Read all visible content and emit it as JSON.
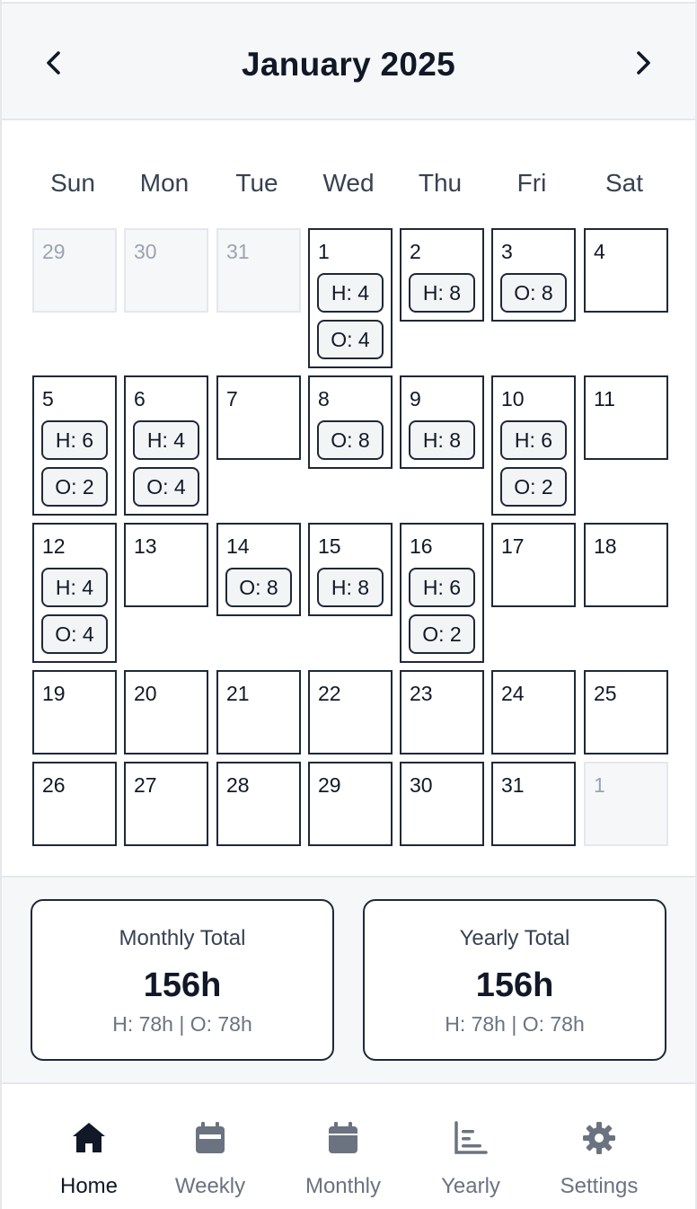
{
  "header": {
    "month_title": "January 2025"
  },
  "weekdays": [
    "Sun",
    "Mon",
    "Tue",
    "Wed",
    "Thu",
    "Fri",
    "Sat"
  ],
  "weeks": [
    [
      {
        "day": "29",
        "muted": true,
        "entries": []
      },
      {
        "day": "30",
        "muted": true,
        "entries": []
      },
      {
        "day": "31",
        "muted": true,
        "entries": []
      },
      {
        "day": "1",
        "muted": false,
        "entries": [
          "H: 4",
          "O: 4"
        ]
      },
      {
        "day": "2",
        "muted": false,
        "entries": [
          "H: 8"
        ]
      },
      {
        "day": "3",
        "muted": false,
        "entries": [
          "O: 8"
        ]
      },
      {
        "day": "4",
        "muted": false,
        "entries": []
      }
    ],
    [
      {
        "day": "5",
        "muted": false,
        "entries": [
          "H: 6",
          "O: 2"
        ]
      },
      {
        "day": "6",
        "muted": false,
        "entries": [
          "H: 4",
          "O: 4"
        ]
      },
      {
        "day": "7",
        "muted": false,
        "entries": []
      },
      {
        "day": "8",
        "muted": false,
        "entries": [
          "O: 8"
        ]
      },
      {
        "day": "9",
        "muted": false,
        "entries": [
          "H: 8"
        ]
      },
      {
        "day": "10",
        "muted": false,
        "entries": [
          "H: 6",
          "O: 2"
        ]
      },
      {
        "day": "11",
        "muted": false,
        "entries": []
      }
    ],
    [
      {
        "day": "12",
        "muted": false,
        "entries": [
          "H: 4",
          "O: 4"
        ]
      },
      {
        "day": "13",
        "muted": false,
        "entries": []
      },
      {
        "day": "14",
        "muted": false,
        "entries": [
          "O: 8"
        ]
      },
      {
        "day": "15",
        "muted": false,
        "entries": [
          "H: 8"
        ]
      },
      {
        "day": "16",
        "muted": false,
        "entries": [
          "H: 6",
          "O: 2"
        ]
      },
      {
        "day": "17",
        "muted": false,
        "entries": []
      },
      {
        "day": "18",
        "muted": false,
        "entries": []
      }
    ],
    [
      {
        "day": "19",
        "muted": false,
        "entries": []
      },
      {
        "day": "20",
        "muted": false,
        "entries": []
      },
      {
        "day": "21",
        "muted": false,
        "entries": []
      },
      {
        "day": "22",
        "muted": false,
        "entries": []
      },
      {
        "day": "23",
        "muted": false,
        "entries": []
      },
      {
        "day": "24",
        "muted": false,
        "entries": []
      },
      {
        "day": "25",
        "muted": false,
        "entries": []
      }
    ],
    [
      {
        "day": "26",
        "muted": false,
        "entries": []
      },
      {
        "day": "27",
        "muted": false,
        "entries": []
      },
      {
        "day": "28",
        "muted": false,
        "entries": []
      },
      {
        "day": "29",
        "muted": false,
        "entries": []
      },
      {
        "day": "30",
        "muted": false,
        "entries": []
      },
      {
        "day": "31",
        "muted": false,
        "entries": []
      },
      {
        "day": "1",
        "muted": true,
        "entries": []
      }
    ]
  ],
  "totals": {
    "monthly": {
      "title": "Monthly Total",
      "value": "156h",
      "breakdown": "H: 78h | O: 78h"
    },
    "yearly": {
      "title": "Yearly Total",
      "value": "156h",
      "breakdown": "H: 78h | O: 78h"
    }
  },
  "tabs": [
    {
      "label": "Home",
      "icon": "home-icon",
      "active": true
    },
    {
      "label": "Weekly",
      "icon": "calendar-week-icon",
      "active": false
    },
    {
      "label": "Monthly",
      "icon": "calendar-month-icon",
      "active": false
    },
    {
      "label": "Yearly",
      "icon": "chart-bar-icon",
      "active": false
    },
    {
      "label": "Settings",
      "icon": "gear-icon",
      "active": false
    }
  ],
  "colors": {
    "text_primary": "#111827",
    "text_muted": "#6b7280",
    "border": "#1f2937",
    "surface_muted": "#f6f7f9",
    "badge_bg": "#f3f4f6"
  }
}
